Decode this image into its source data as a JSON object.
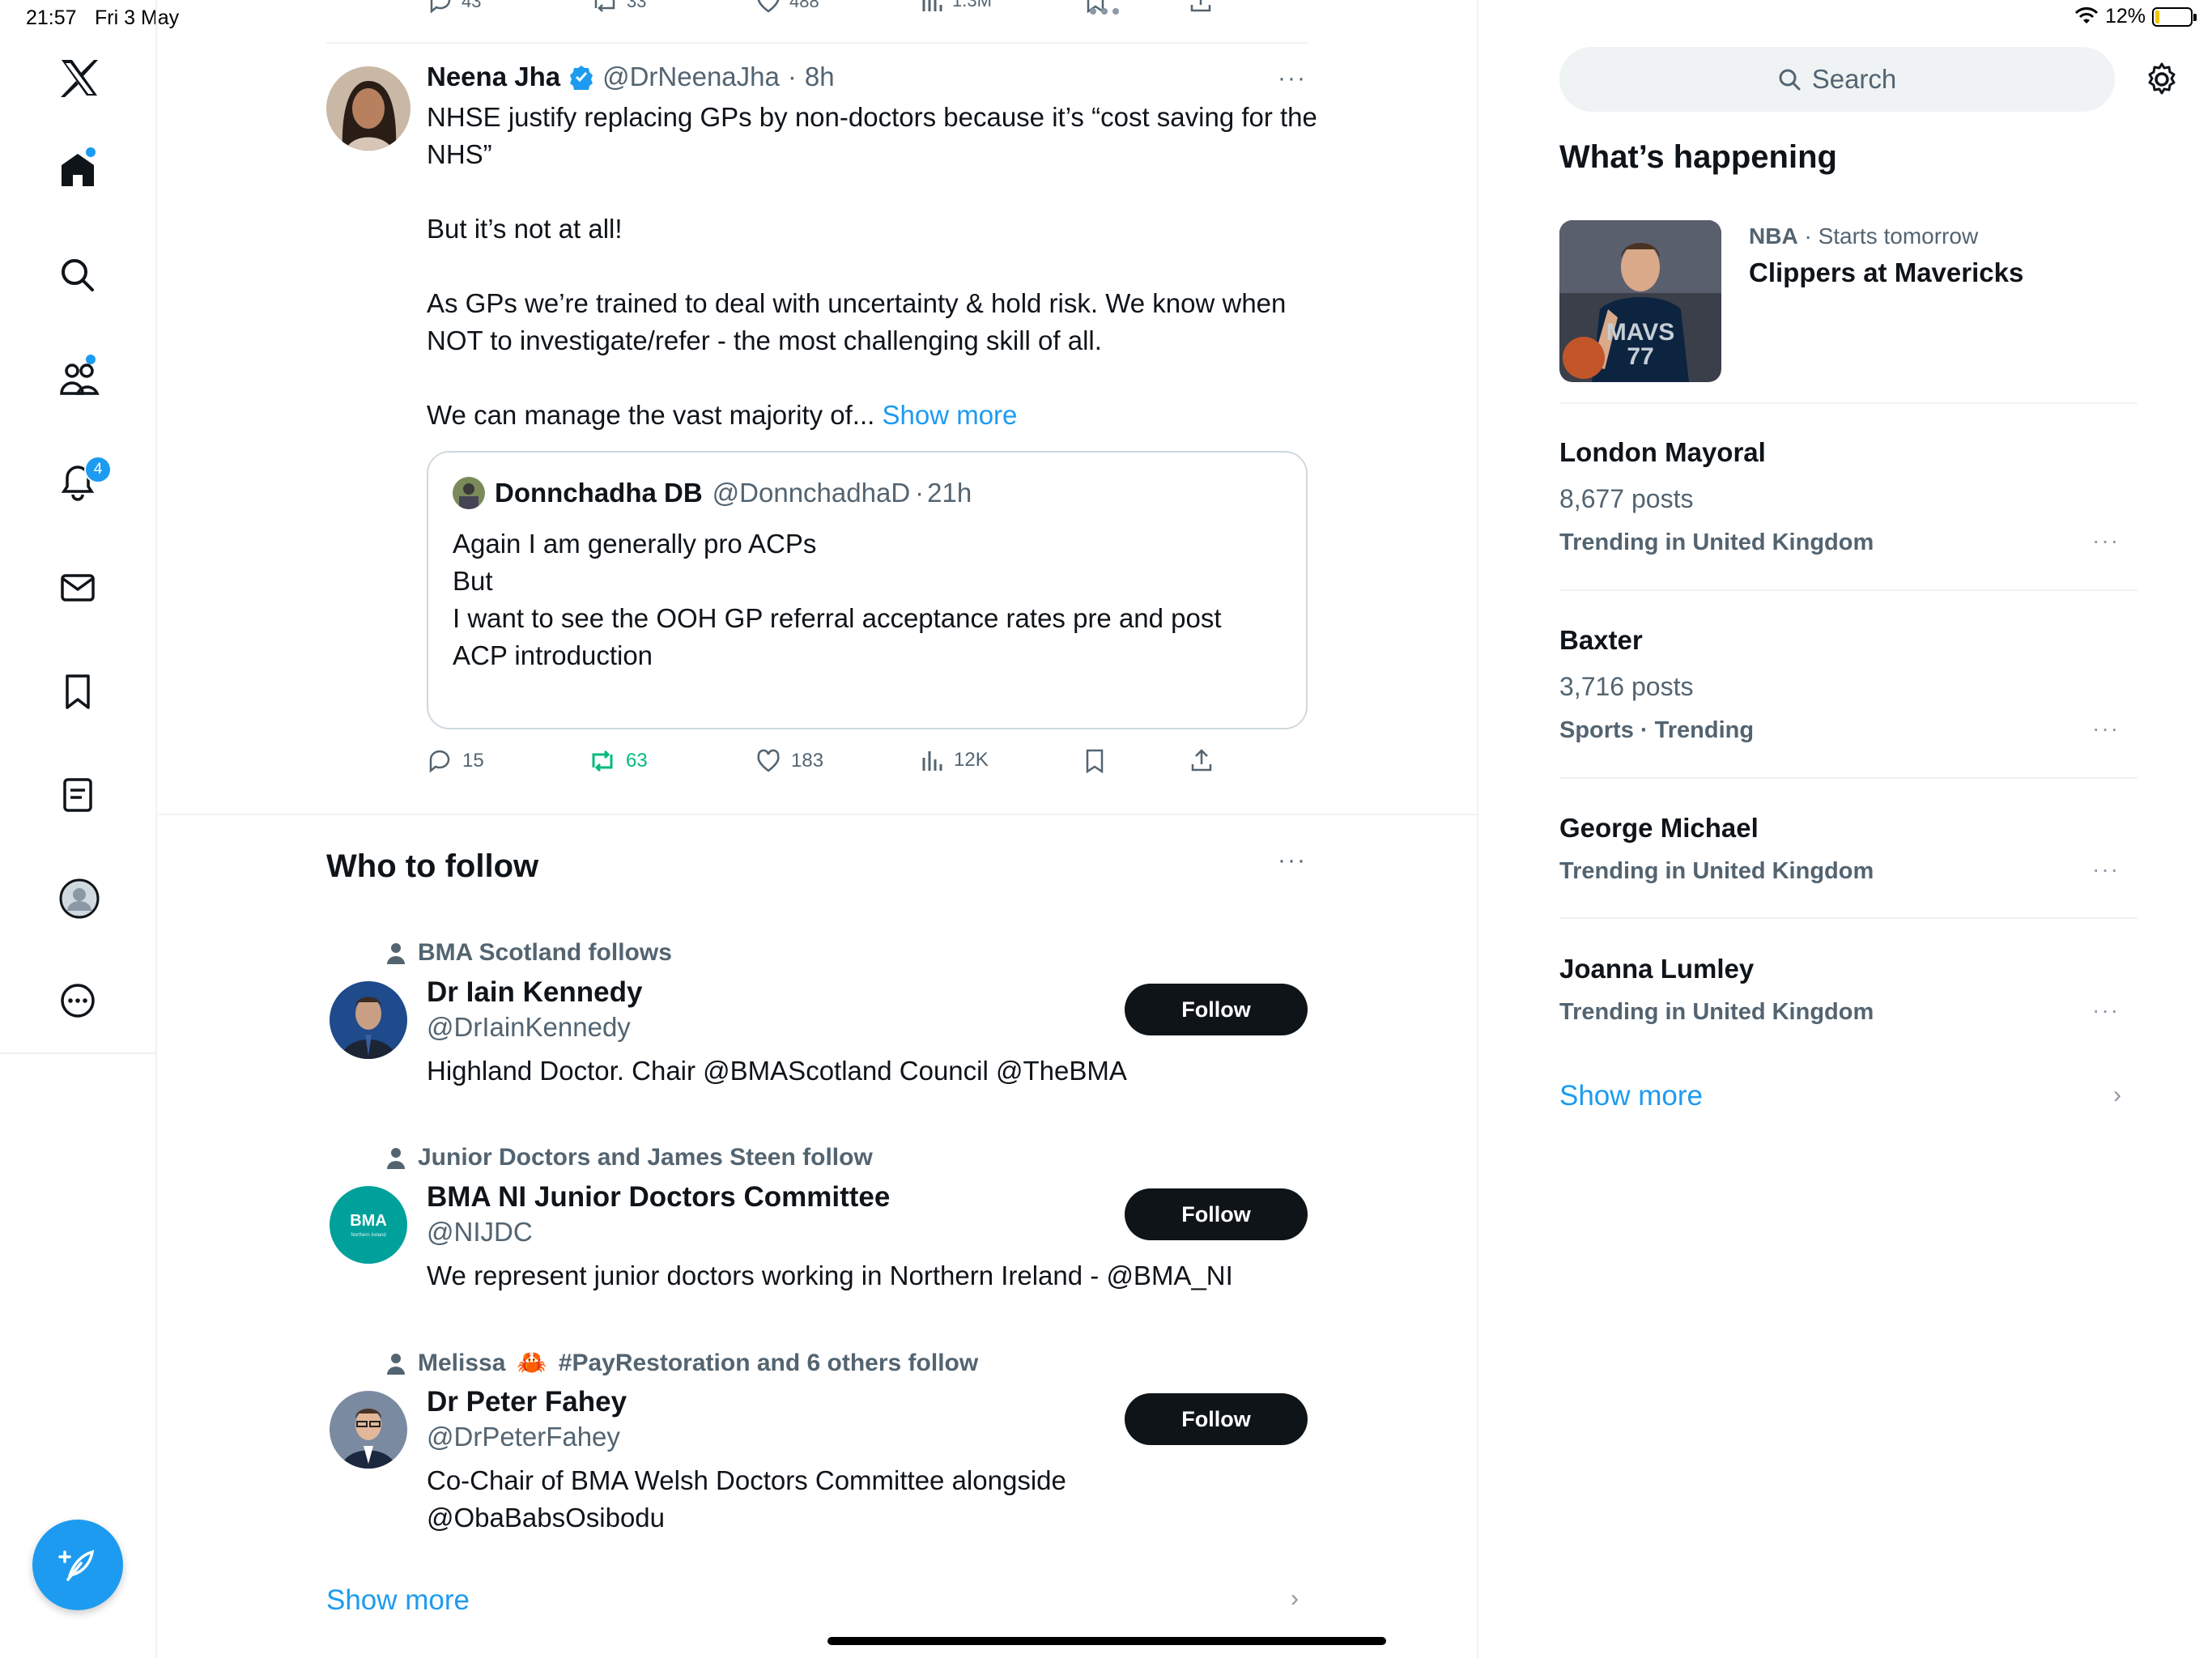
{
  "status_bar": {
    "time": "21:57",
    "date": "Fri 3 May",
    "battery": "12%",
    "battery_level": 0.12
  },
  "sidebar": {
    "items": [
      {
        "icon": "x-logo-icon"
      },
      {
        "icon": "home-icon",
        "dot": true
      },
      {
        "icon": "search-icon"
      },
      {
        "icon": "communities-icon",
        "dot": true
      },
      {
        "icon": "bell-icon",
        "badge": "4"
      },
      {
        "icon": "mail-icon"
      },
      {
        "icon": "bookmark-icon"
      },
      {
        "icon": "lists-icon"
      },
      {
        "icon": "profile-icon"
      },
      {
        "icon": "more-icon"
      }
    ],
    "compose_icon": "compose-feather-icon"
  },
  "previous_tweet_actions": {
    "replies": "43",
    "reposts": "33",
    "likes": "488",
    "views": "1.3M"
  },
  "tweet": {
    "author": "Neena Jha",
    "handle": "@DrNeenaJha",
    "time": "8h",
    "verified": true,
    "paragraphs": [
      "NHSE justify replacing GPs by non-doctors because it’s “cost saving for the NHS”",
      "But it’s not at all!",
      "As GPs we’re trained to deal with uncertainty & hold risk. We know when NOT to investigate/refer - the most challenging skill of all."
    ],
    "last_line": "We can manage the vast majority of...",
    "show_more": "Show more",
    "quote": {
      "author": "Donnchadha DB",
      "handle": "@DonnchadhaD",
      "time": "21h",
      "body": "Again I am generally pro ACPs\nBut\nI want to see the OOH GP referral acceptance rates pre and post ACP introduction"
    },
    "actions": {
      "replies": "15",
      "reposts": "63",
      "likes": "183",
      "views": "12K"
    }
  },
  "who_to_follow": {
    "title": "Who to follow",
    "follow_label": "Follow",
    "show_more": "Show more",
    "users": [
      {
        "context": "BMA Scotland follows",
        "name": "Dr Iain Kennedy",
        "handle": "@DrIainKennedy",
        "bio": "Highland Doctor. Chair @BMAScotland Council @TheBMA"
      },
      {
        "context": "Junior Doctors and James Steen follow",
        "name": "BMA NI Junior Doctors Committee",
        "handle": "@NIJDC",
        "bio": "We represent junior doctors working in Northern Ireland - @BMA_NI",
        "logo_text": "BMA",
        "logo_sub": "Northern Ireland"
      },
      {
        "context_pre": "Melissa",
        "context_emoji": "🦀",
        "context_post": "#PayRestoration and 6 others follow",
        "name": "Dr Peter Fahey",
        "handle": "@DrPeterFahey",
        "bio": "Co-Chair of BMA Welsh Doctors Committee alongside\n@ObaBabsOsibodu"
      }
    ]
  },
  "right": {
    "search_placeholder": "Search",
    "whats_happening": "What’s happening",
    "event": {
      "category": "NBA",
      "when": "Starts tomorrow",
      "title": "Clippers at Mavericks",
      "jersey_text": "MAVS",
      "jersey_number": "77"
    },
    "trends": [
      {
        "name": "London Mayoral",
        "posts": "8,677 posts",
        "context": "Trending in United Kingdom"
      },
      {
        "name": "Baxter",
        "posts": "3,716 posts",
        "context": "Sports · Trending"
      },
      {
        "name": "George Michael",
        "context": "Trending in United Kingdom"
      },
      {
        "name": "Joanna Lumley",
        "context": "Trending in United Kingdom"
      }
    ],
    "show_more": "Show more"
  },
  "colors": {
    "accent": "#1d9bf0",
    "repost_green": "#00ba7c",
    "text_primary": "#0f1419",
    "text_secondary": "#536471"
  }
}
